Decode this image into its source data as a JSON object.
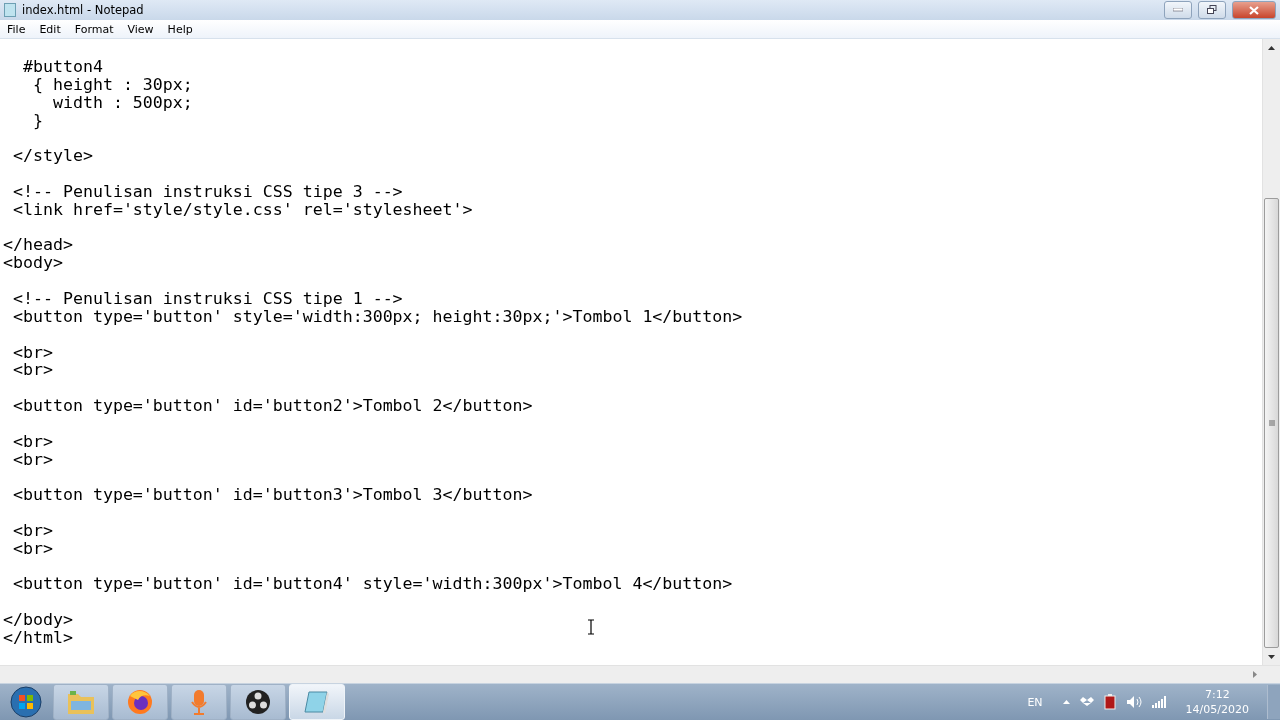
{
  "window": {
    "title": "index.html - Notepad"
  },
  "menu": [
    {
      "label": "File"
    },
    {
      "label": "Edit"
    },
    {
      "label": "Format"
    },
    {
      "label": "View"
    },
    {
      "label": "Help"
    }
  ],
  "lines": [
    {
      "kind": "code",
      "text": "  #button4"
    },
    {
      "kind": "code",
      "text": "   { height : 30px;"
    },
    {
      "kind": "code",
      "text": "     width : 500px;"
    },
    {
      "kind": "code",
      "text": "   }"
    },
    {
      "kind": "blank"
    },
    {
      "kind": "code",
      "text": " </style>"
    },
    {
      "kind": "blank"
    },
    {
      "kind": "code",
      "text": " <!-- Penulisan instruksi CSS tipe 3 -->"
    },
    {
      "kind": "code",
      "text": " <link href='style/style.css' rel='stylesheet'>"
    },
    {
      "kind": "blank"
    },
    {
      "kind": "code",
      "text": "</head>"
    },
    {
      "kind": "code",
      "text": "<body>"
    },
    {
      "kind": "blank"
    },
    {
      "kind": "code",
      "text": " <!-- Penulisan instruksi CSS tipe 1 -->"
    },
    {
      "kind": "code",
      "text": " <button type='button' style='width:300px; height:30px;'>Tombol 1</button>"
    },
    {
      "kind": "blank"
    },
    {
      "kind": "code",
      "text": " <br>"
    },
    {
      "kind": "code",
      "text": " <br>"
    },
    {
      "kind": "blank"
    },
    {
      "kind": "code",
      "text": " <button type='button' id='button2'>Tombol 2</button>"
    },
    {
      "kind": "blank"
    },
    {
      "kind": "code",
      "text": " <br>"
    },
    {
      "kind": "code",
      "text": " <br>"
    },
    {
      "kind": "blank"
    },
    {
      "kind": "code",
      "text": " <button type='button' id='button3'>Tombol 3</button>"
    },
    {
      "kind": "blank"
    },
    {
      "kind": "code",
      "text": " <br>"
    },
    {
      "kind": "code",
      "text": " <br>"
    },
    {
      "kind": "blank"
    },
    {
      "kind": "code",
      "text": " <button type='button' id='button4' style='width:300px'>Tombol 4</button>"
    },
    {
      "kind": "blank"
    },
    {
      "kind": "code",
      "text": "</body>"
    },
    {
      "kind": "code",
      "text": "</html>"
    }
  ],
  "taskbar": {
    "apps": [
      {
        "kind": "folder",
        "selected": false
      },
      {
        "kind": "browser",
        "selected": false
      },
      {
        "kind": "microphone",
        "selected": false
      },
      {
        "kind": "recorder",
        "selected": false
      },
      {
        "kind": "notepad",
        "selected": true
      }
    ],
    "language": "EN",
    "time": "7:12",
    "date": "14/05/2020"
  }
}
